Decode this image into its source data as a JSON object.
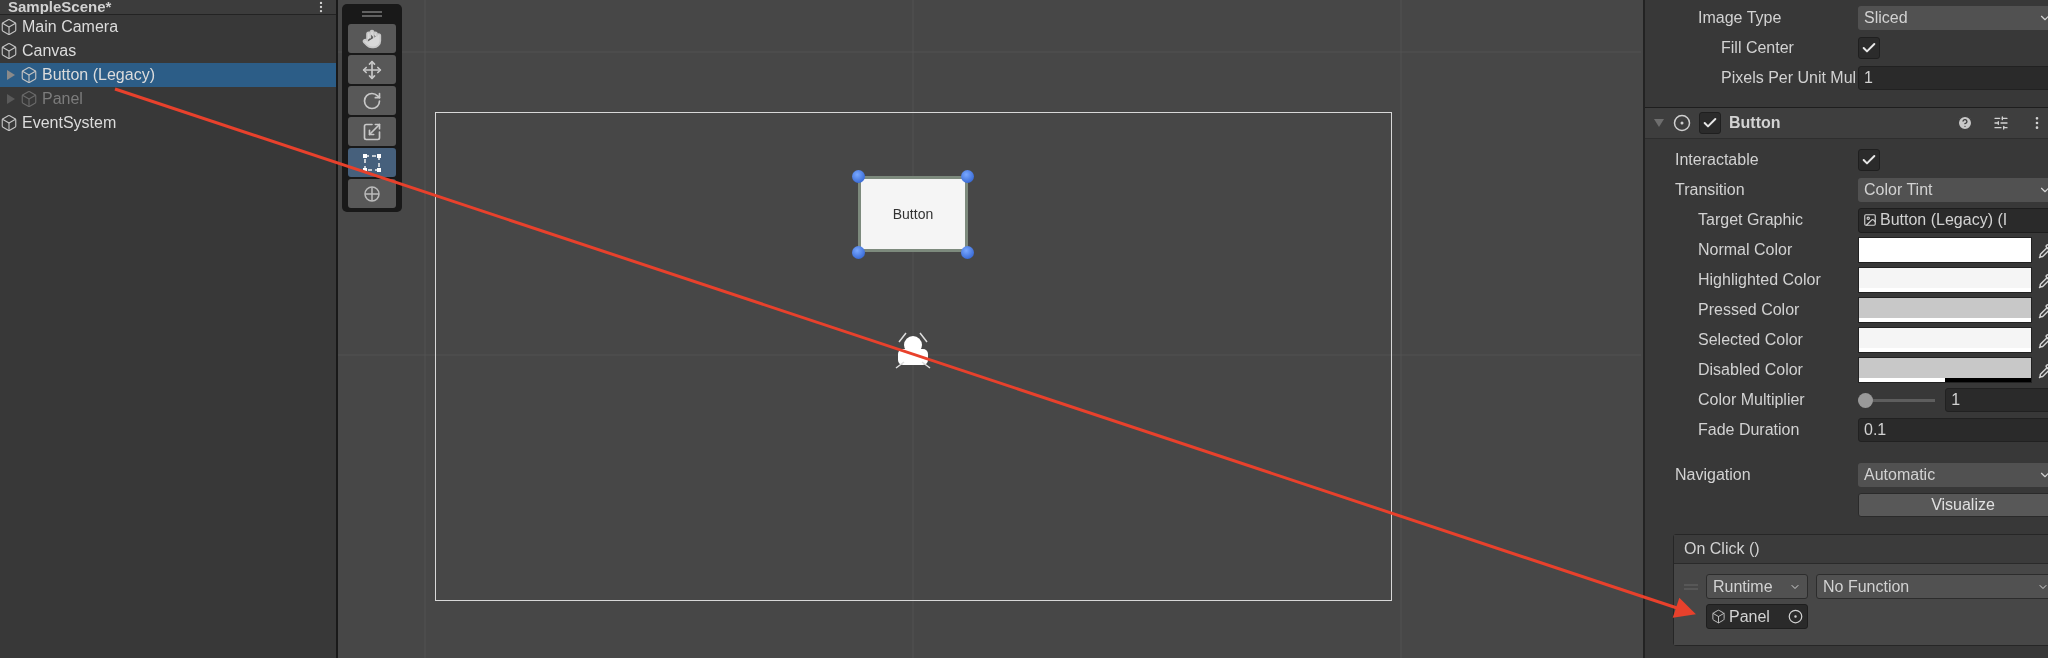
{
  "hierarchy": {
    "title": "SampleScene*",
    "items": [
      {
        "label": "Main Camera",
        "kind": "leaf",
        "selected": false,
        "disabled": false
      },
      {
        "label": "Canvas",
        "kind": "leaf",
        "selected": false,
        "disabled": false,
        "children": [
          {
            "label": "Button (Legacy)",
            "kind": "group",
            "selected": true,
            "disabled": false
          },
          {
            "label": "Panel",
            "kind": "group",
            "selected": false,
            "disabled": true
          }
        ]
      },
      {
        "label": "EventSystem",
        "kind": "leaf",
        "selected": false,
        "disabled": false
      }
    ]
  },
  "scene": {
    "tools": [
      {
        "kind": "hand",
        "selected": false
      },
      {
        "kind": "move",
        "selected": false
      },
      {
        "kind": "rotate",
        "selected": false
      },
      {
        "kind": "scale",
        "selected": false
      },
      {
        "kind": "rect",
        "selected": true
      },
      {
        "kind": "transform",
        "selected": false
      }
    ],
    "button_label": "Button"
  },
  "inspector": {
    "image_rows": [
      {
        "label": "Image Type",
        "kind": "dropdown",
        "value": "Sliced",
        "children": [
          {
            "label": "Fill Center",
            "kind": "checkbox",
            "checked": true
          },
          {
            "label": "Pixels Per Unit Mul",
            "kind": "field",
            "value": "1"
          }
        ]
      }
    ],
    "component": {
      "title": "Button",
      "enabled": true,
      "expanded": true,
      "rows": [
        {
          "label": "Interactable",
          "kind": "checkbox",
          "checked": true
        },
        {
          "label": "Transition",
          "kind": "dropdown",
          "value": "Color Tint",
          "children": [
            {
              "label": "Target Graphic",
              "kind": "object",
              "value": "Button (Legacy) (I"
            },
            {
              "label": "Normal Color",
              "kind": "color",
              "color": "#ffffff",
              "level": 1
            },
            {
              "label": "Highlighted Color",
              "kind": "color",
              "color": "#f5f5f5",
              "level": 1
            },
            {
              "label": "Pressed Color",
              "kind": "color",
              "color": "#c8c8c8",
              "level": 1
            },
            {
              "label": "Selected Color",
              "kind": "color",
              "color": "#f5f5f5",
              "level": 1
            },
            {
              "label": "Disabled Color",
              "kind": "color",
              "color": "#c8c8c8",
              "level": 0.5
            },
            {
              "label": "Color Multiplier",
              "kind": "slider",
              "level": 0,
              "value": "1"
            },
            {
              "label": "Fade Duration",
              "kind": "field",
              "value": "0.1"
            }
          ]
        },
        {
          "label": "Navigation",
          "kind": "dropdown",
          "value": "Automatic"
        },
        {
          "kind": "button",
          "value": "Visualize"
        }
      ]
    },
    "on_click": {
      "title": "On Click ()",
      "entries": [
        {
          "mode": "Runtime",
          "function": "No Function",
          "target": "Panel"
        }
      ]
    }
  }
}
